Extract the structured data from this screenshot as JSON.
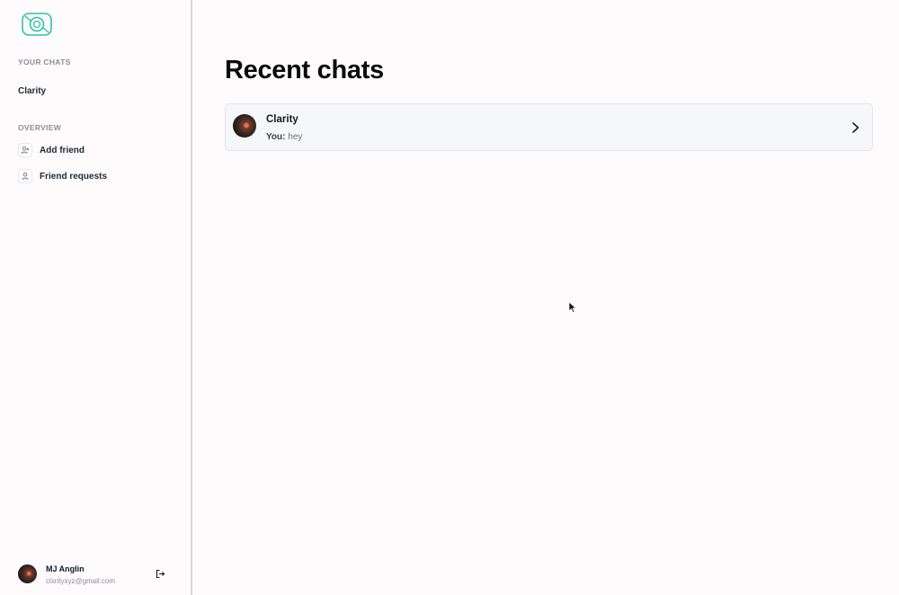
{
  "sidebar": {
    "logo_icon": "chat-bubble-logo-icon",
    "your_chats_label": "YOUR CHATS",
    "chats": [
      {
        "name": "Clarity"
      }
    ],
    "overview_label": "OVERVIEW",
    "nav": [
      {
        "label": "Add friend",
        "icon": "user-plus-icon"
      },
      {
        "label": "Friend requests",
        "icon": "user-icon"
      }
    ]
  },
  "profile": {
    "name": "MJ Anglin",
    "email": "clxrityxyz@gmail.com",
    "logout_icon": "logout-icon"
  },
  "main": {
    "title": "Recent chats",
    "recent": [
      {
        "name": "Clarity",
        "prefix": "You:",
        "message": "hey"
      }
    ]
  },
  "colors": {
    "accent": "#2dc4a3",
    "background": "#fdfbfc",
    "card": "#f6f7f8"
  }
}
